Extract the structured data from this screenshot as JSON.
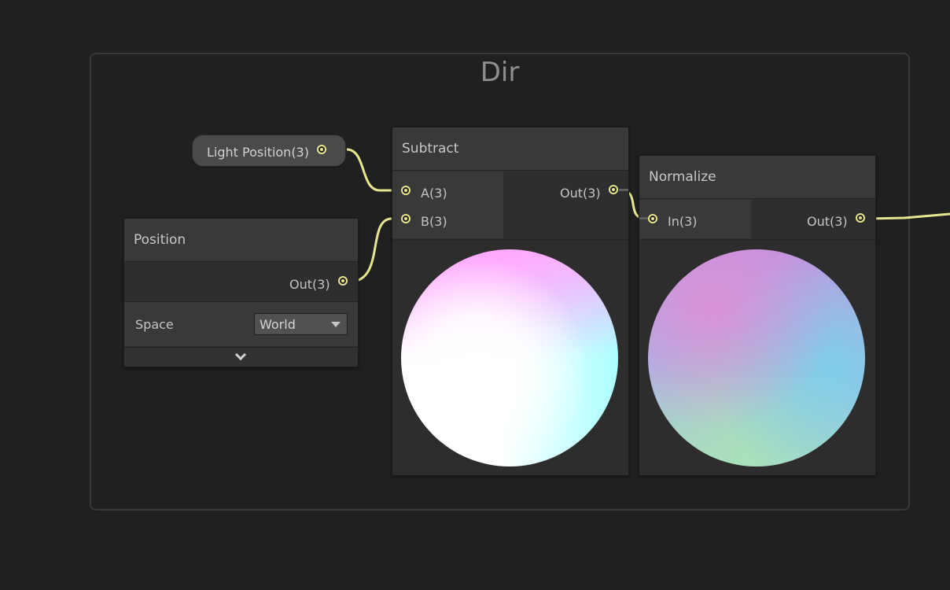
{
  "group": {
    "title": "Dir"
  },
  "property_node": {
    "label": "Light Position(3)"
  },
  "position_node": {
    "title": "Position",
    "output_label": "Out(3)",
    "space_label": "Space",
    "space_value": "World"
  },
  "subtract_node": {
    "title": "Subtract",
    "input_a_label": "A(3)",
    "input_b_label": "B(3)",
    "output_label": "Out(3)"
  },
  "normalize_node": {
    "title": "Normalize",
    "input_label": "In(3)",
    "output_label": "Out(3)"
  },
  "colors": {
    "background": "#202020",
    "wire": "#e7e690",
    "node_header": "#393939",
    "node_body": "#2e2e2e"
  },
  "icons": {
    "port": "port-circle-icon",
    "dropdown": "dropdown-arrow-icon",
    "collapse": "chevron-down-icon"
  }
}
